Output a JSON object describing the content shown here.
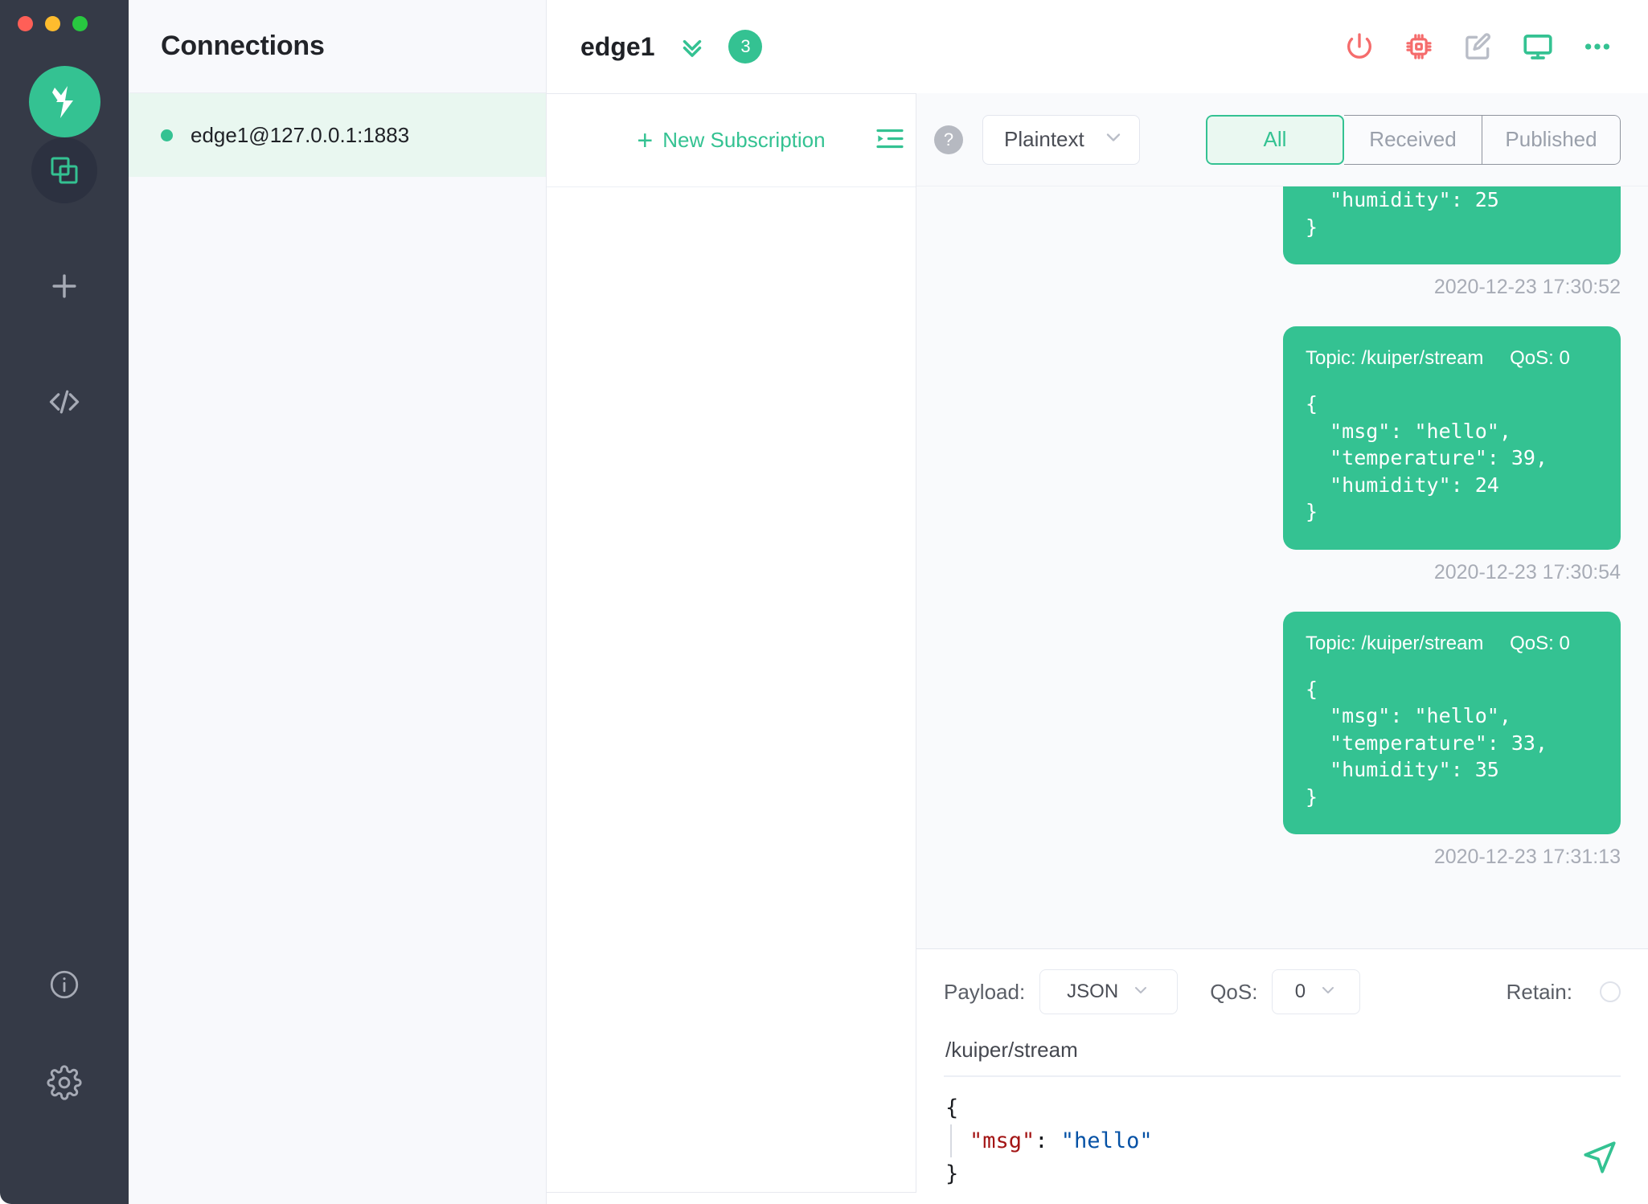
{
  "window": {
    "traffic_lights": [
      "close",
      "minimize",
      "maximize"
    ]
  },
  "rail": {
    "logo_icon": "mqttx-logo-icon",
    "items": [
      {
        "name": "connections",
        "icon": "stacked-squares-icon",
        "active": true
      },
      {
        "name": "new-connection",
        "icon": "plus-icon",
        "active": false
      },
      {
        "name": "scripts",
        "icon": "code-brackets-icon",
        "active": false
      }
    ],
    "bottom_items": [
      {
        "name": "about",
        "icon": "info-circle-icon"
      },
      {
        "name": "settings",
        "icon": "gear-icon"
      }
    ]
  },
  "connections": {
    "title": "Connections",
    "items": [
      {
        "label": "edge1@127.0.0.1:1883",
        "status": "connected",
        "selected": true
      }
    ]
  },
  "topbar": {
    "title": "edge1",
    "collapse_icon": "double-chevron-down-icon",
    "badge": "3",
    "actions": [
      {
        "name": "disconnect-button",
        "icon": "power-icon",
        "color": "#f56c6c"
      },
      {
        "name": "debug-button",
        "icon": "chip-icon",
        "color": "#f56c6c"
      },
      {
        "name": "edit-button",
        "icon": "edit-square-icon",
        "color": "#b9bdc7"
      },
      {
        "name": "monitor-button",
        "icon": "monitor-icon",
        "color": "#34c292"
      },
      {
        "name": "more-button",
        "icon": "ellipsis-icon",
        "color": "#34c292"
      }
    ]
  },
  "subscriptions": {
    "new_label": "New Subscription",
    "plus": "+",
    "fold_icon": "menu-fold-icon",
    "items": []
  },
  "messages_toolbar": {
    "help": "?",
    "format": {
      "value": "Plaintext",
      "caret": "chevron-down-icon"
    },
    "filters": [
      {
        "label": "All",
        "active": true
      },
      {
        "label": "Received",
        "active": false
      },
      {
        "label": "Published",
        "active": false
      }
    ]
  },
  "messages": [
    {
      "clipped": true,
      "topic": "",
      "qos": "",
      "body": "  \"humidity\": 25\n}",
      "time": "2020-12-23 17:30:52"
    },
    {
      "clipped": false,
      "topic": "Topic: /kuiper/stream",
      "qos": "QoS: 0",
      "body": "{\n  \"msg\": \"hello\",\n  \"temperature\": 39,\n  \"humidity\": 24\n}",
      "time": "2020-12-23 17:30:54"
    },
    {
      "clipped": false,
      "topic": "Topic: /kuiper/stream",
      "qos": "QoS: 0",
      "body": "{\n  \"msg\": \"hello\",\n  \"temperature\": 33,\n  \"humidity\": 35\n}",
      "time": "2020-12-23 17:31:13"
    }
  ],
  "publish": {
    "payload_label": "Payload:",
    "payload_value": "JSON",
    "qos_label": "QoS:",
    "qos_value": "0",
    "retain_label": "Retain:",
    "retain_checked": false,
    "topic": "/kuiper/stream",
    "editor": {
      "line1": "{",
      "key": "\"msg\"",
      "colon": ": ",
      "value": "\"hello\"",
      "line3": "}"
    },
    "send_icon": "send-arrow-icon"
  },
  "colors": {
    "brand_green": "#34c292",
    "rail_dark": "#353a47",
    "danger_red": "#f56c6c",
    "bubble_green": "#34c292",
    "panel_bg": "#f9fafc"
  }
}
